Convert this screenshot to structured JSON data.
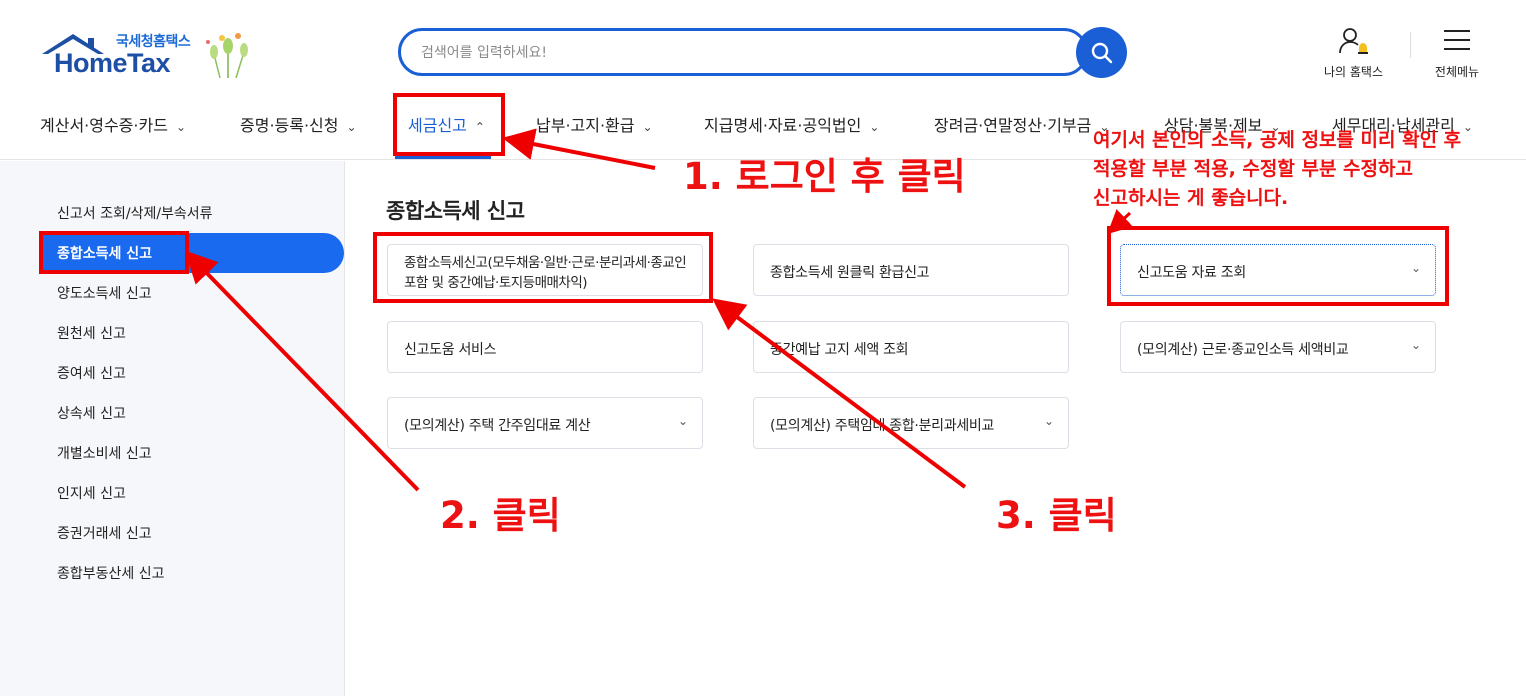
{
  "header": {
    "logo_sub": "국세청홈택스",
    "logo_main": "HomeTax",
    "search_placeholder": "검색어를 입력하세요!",
    "my_hometax": "나의 홈택스",
    "all_menu": "전체메뉴"
  },
  "nav": {
    "items": [
      {
        "label": "계산서·영수증·카드"
      },
      {
        "label": "증명·등록·신청"
      },
      {
        "label": "세금신고"
      },
      {
        "label": "납부·고지·환급"
      },
      {
        "label": "지급명세·자료·공익법인"
      },
      {
        "label": "장려금·연말정산·기부금"
      },
      {
        "label": "상담·불복·제보"
      },
      {
        "label": "세무대리·납세관리"
      }
    ]
  },
  "sidebar": {
    "items": [
      {
        "label": "신고서 조회/삭제/부속서류"
      },
      {
        "label": "종합소득세 신고"
      },
      {
        "label": "양도소득세 신고"
      },
      {
        "label": "원천세 신고"
      },
      {
        "label": "증여세 신고"
      },
      {
        "label": "상속세 신고"
      },
      {
        "label": "개별소비세 신고"
      },
      {
        "label": "인지세 신고"
      },
      {
        "label": "증권거래세 신고"
      },
      {
        "label": "종합부동산세 신고"
      }
    ]
  },
  "main": {
    "title": "종합소득세 신고",
    "cards": [
      {
        "label": "종합소득세신고(모두채움·일반·근로·분리과세·종교인포함 및 중간예납·토지등매매차익)"
      },
      {
        "label": "종합소득세 원클릭 환급신고"
      },
      {
        "label": "신고도움 자료 조회"
      },
      {
        "label": "신고도움 서비스"
      },
      {
        "label": "중간예납 고지 세액 조회"
      },
      {
        "label": "(모의계산) 근로·종교인소득 세액비교"
      },
      {
        "label": "(모의계산) 주택 간주임대료 계산"
      },
      {
        "label": "(모의계산) 주택임대 종합·분리과세비교"
      }
    ]
  },
  "annotations": {
    "step1": "1. 로그인 후 클릭",
    "step2": "2. 클릭",
    "step3": "3. 클릭",
    "note_line1": "여기서 본인의 소득, 공제 정보를 미리 확인 후",
    "note_line2": "적용할 부분 적용, 수정할 부분 수정하고",
    "note_line3": "신고하시는 게 좋습니다."
  },
  "colors": {
    "accent": "#1a5fd6",
    "active_sidebar": "#1a6af0",
    "annotation_red": "#ee0000"
  }
}
